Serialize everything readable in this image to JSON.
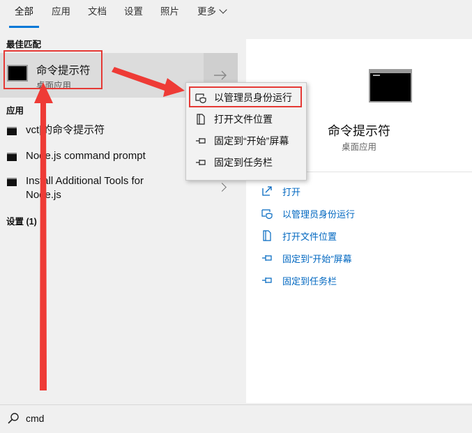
{
  "tabs": [
    {
      "label": "全部"
    },
    {
      "label": "应用"
    },
    {
      "label": "文档"
    },
    {
      "label": "设置"
    },
    {
      "label": "照片"
    },
    {
      "label": "更多"
    }
  ],
  "left": {
    "best_match_header": "最佳匹配",
    "best_match": {
      "title": "命令提示符",
      "subtitle": "桌面应用"
    },
    "apps_header": "应用",
    "apps": [
      {
        "label": "vct|的命令提示符"
      },
      {
        "label": "Node.js command prompt"
      },
      {
        "label": "Install Additional Tools for Node.js"
      }
    ],
    "settings_header": "设置 (1)"
  },
  "context_menu": {
    "items": [
      {
        "label": "以管理员身份运行",
        "icon": "shield-icon"
      },
      {
        "label": "打开文件位置",
        "icon": "file-location-icon"
      },
      {
        "label": "固定到“开始”屏幕",
        "icon": "pin-icon"
      },
      {
        "label": "固定到任务栏",
        "icon": "pin-icon"
      }
    ]
  },
  "right": {
    "title": "命令提示符",
    "subtitle": "桌面应用",
    "actions": [
      {
        "label": "打开",
        "icon": "open-icon"
      },
      {
        "label": "以管理员身份运行",
        "icon": "shield-icon"
      },
      {
        "label": "打开文件位置",
        "icon": "file-location-icon"
      },
      {
        "label": "固定到“开始”屏幕",
        "icon": "pin-icon"
      },
      {
        "label": "固定到任务栏",
        "icon": "pin-icon"
      }
    ]
  },
  "search": {
    "value": "cmd"
  },
  "colors": {
    "accent": "#0078d7",
    "link": "#0067c0",
    "highlight": "#e53935"
  }
}
